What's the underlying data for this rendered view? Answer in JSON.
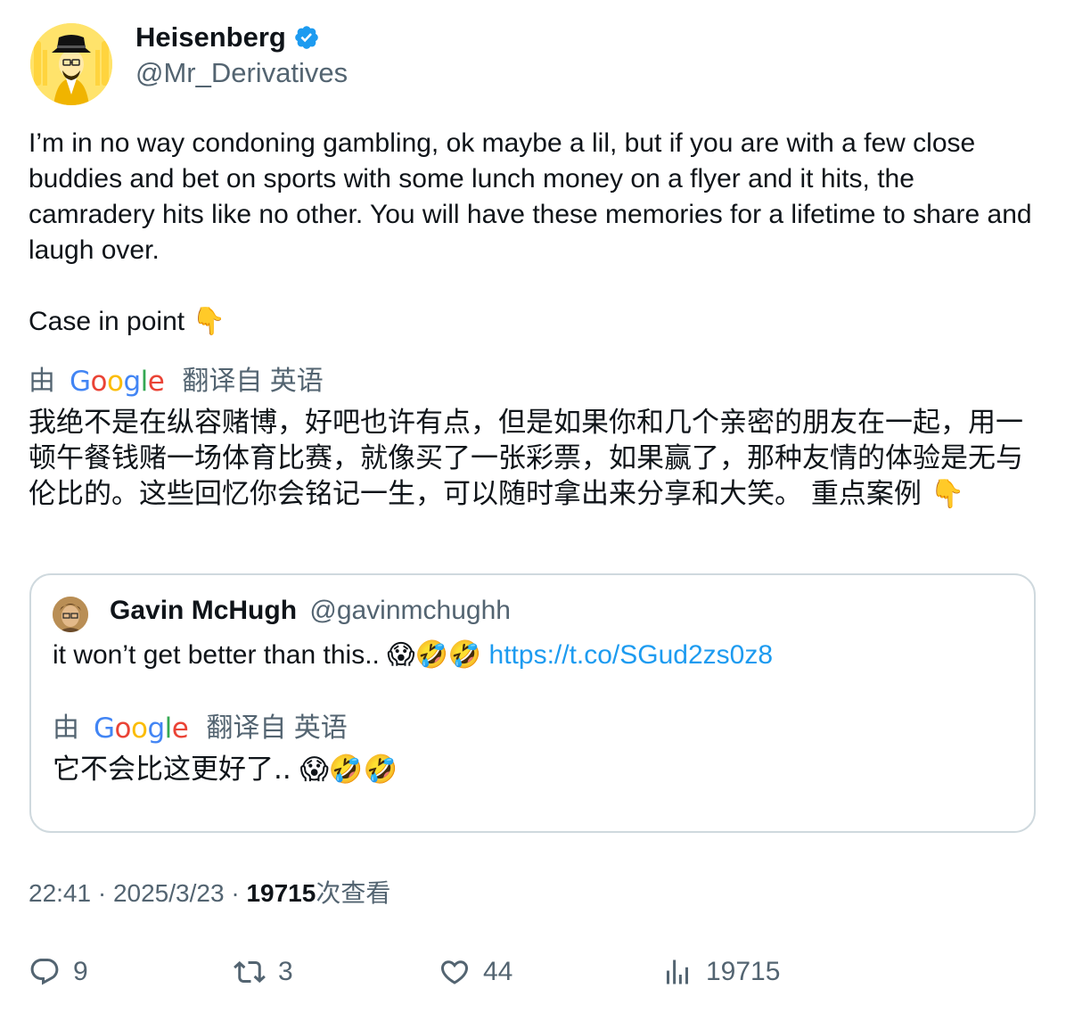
{
  "author": {
    "display_name": "Heisenberg",
    "handle": "@Mr_Derivatives",
    "verified": true,
    "avatar_icon": "heisenberg-avatar"
  },
  "tweet": {
    "text": "I’m in no way condoning gambling, ok maybe a lil, but if you are with a few close buddies and bet on sports with some lunch money on a flyer and it hits, the camradery hits like no other. You will have these memories for a lifetime to share and laugh over.\n\nCase in point 👇",
    "translation": {
      "by_label": "由",
      "provider": "Google",
      "from_label": "翻译自 英语",
      "text": "我绝不是在纵容赌博，好吧也许有点，但是如果你和几个亲密的朋友在一起，用一顿午餐钱赌一场体育比赛，就像买了一张彩票，如果赢了，那种友情的体验是无与伦比的。这些回忆你会铭记一生，可以随时拿出来分享和大笑。 重点案例 👇"
    }
  },
  "quoted_tweet": {
    "display_name": "Gavin McHugh",
    "handle": "@gavinmchughh",
    "text": "it won’t get better than this.. 😱🤣🤣",
    "link": "https://t.co/SGud2zs0z8",
    "translation": {
      "by_label": "由",
      "provider": "Google",
      "from_label": "翻译自 英语",
      "text": "它不会比这更好了.. 😱🤣🤣"
    }
  },
  "meta": {
    "time": "22:41",
    "separator": "·",
    "date": "2025/3/23",
    "views": "19715",
    "views_suffix": "次查看"
  },
  "actions": {
    "replies": "9",
    "retweets": "3",
    "likes": "44",
    "views": "19715"
  },
  "colors": {
    "text": "#0f1419",
    "secondary": "#536471",
    "link": "#1d9bf0",
    "verified": "#1d9bf0",
    "border": "#cfd9de"
  }
}
